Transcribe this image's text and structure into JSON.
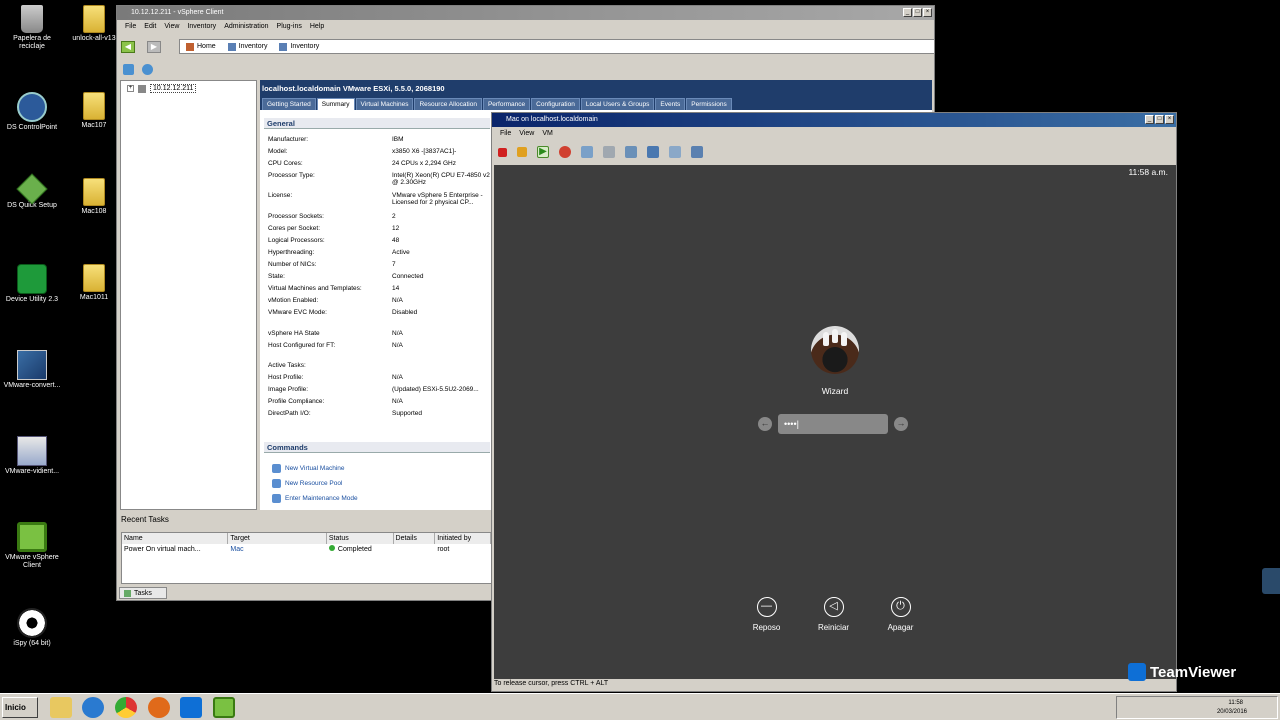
{
  "desktop": {
    "icons": [
      {
        "label": "Papelera de reciclaje"
      },
      {
        "label": "unlock-all-v13"
      },
      {
        "label": "DS ControlPoint"
      },
      {
        "label": "Mac107"
      },
      {
        "label": "DS Quick Setup"
      },
      {
        "label": "Mac108"
      },
      {
        "label": "Device Utility 2.3"
      },
      {
        "label": "Mac1011"
      },
      {
        "label": "VMware-convert..."
      },
      {
        "label": "VMware-vidient..."
      },
      {
        "label": "VMware vSphere Client"
      },
      {
        "label": "iSpy (64 bit)"
      }
    ]
  },
  "vsphere": {
    "title": "10.12.12.211 - vSphere Client",
    "menu": [
      "File",
      "Edit",
      "View",
      "Inventory",
      "Administration",
      "Plug-ins",
      "Help"
    ],
    "breadcrumbs": [
      "Home",
      "Inventory",
      "Inventory"
    ],
    "tree_host": "10.12.12.211",
    "host_header": "localhost.localdomain VMware ESXi, 5.5.0, 2068190",
    "tabs": [
      "Getting Started",
      "Summary",
      "Virtual Machines",
      "Resource Allocation",
      "Performance",
      "Configuration",
      "Local Users & Groups",
      "Events",
      "Permissions"
    ],
    "general_title": "General",
    "general": [
      {
        "k": "Manufacturer:",
        "v": "IBM"
      },
      {
        "k": "Model:",
        "v": "x3850 X6 -[3837AC1]-"
      },
      {
        "k": "CPU Cores:",
        "v": "24 CPUs x 2,294 GHz"
      },
      {
        "k": "Processor Type:",
        "v": "Intel(R) Xeon(R) CPU E7-4850 v2 @ 2.30GHz"
      },
      {
        "k": "License:",
        "v": "VMware vSphere 5 Enterprise - Licensed for 2 physical CP..."
      },
      {
        "k": "Processor Sockets:",
        "v": "2"
      },
      {
        "k": "Cores per Socket:",
        "v": "12"
      },
      {
        "k": "Logical Processors:",
        "v": "48"
      },
      {
        "k": "Hyperthreading:",
        "v": "Active"
      },
      {
        "k": "Number of NICs:",
        "v": "7"
      },
      {
        "k": "State:",
        "v": "Connected"
      },
      {
        "k": "Virtual Machines and Templates:",
        "v": "14"
      },
      {
        "k": "vMotion Enabled:",
        "v": "N/A"
      },
      {
        "k": "VMware EVC Mode:",
        "v": "Disabled"
      },
      {
        "k": "vSphere HA State",
        "v": "N/A"
      },
      {
        "k": "Host Configured for FT:",
        "v": "N/A"
      },
      {
        "k": "Active Tasks:",
        "v": ""
      },
      {
        "k": "Host Profile:",
        "v": "N/A"
      },
      {
        "k": "Image Profile:",
        "v": "(Updated) ESXi-5.5U2-2069..."
      },
      {
        "k": "Profile Compliance:",
        "v": "N/A"
      },
      {
        "k": "DirectPath I/O:",
        "v": "Supported"
      }
    ],
    "commands_title": "Commands",
    "commands": [
      "New Virtual Machine",
      "New Resource Pool",
      "Enter Maintenance Mode"
    ],
    "recent_tasks": {
      "title": "Recent Tasks",
      "columns": [
        "Name",
        "Target",
        "Status",
        "Details",
        "Initiated by"
      ],
      "rows": [
        {
          "name": "Power On virtual mach...",
          "target": "Mac",
          "status": "Completed",
          "details": "",
          "initiated": "root"
        }
      ]
    },
    "tasks_tab": "Tasks"
  },
  "vm": {
    "title": "Mac on localhost.localdomain",
    "menu": [
      "File",
      "View",
      "VM"
    ],
    "clock": "11:58 a.m.",
    "username": "Wizard",
    "password_mask": "••••",
    "power": [
      {
        "label": "Reposo",
        "icon": "sleep-icon"
      },
      {
        "label": "Reiniciar",
        "icon": "restart-icon"
      },
      {
        "label": "Apagar",
        "icon": "power-icon"
      }
    ],
    "status": "To release cursor, press CTRL + ALT"
  },
  "teamviewer": "TeamViewer",
  "taskbar": {
    "start": "Inicio",
    "time": "11:58",
    "date": "20/03/2016"
  }
}
